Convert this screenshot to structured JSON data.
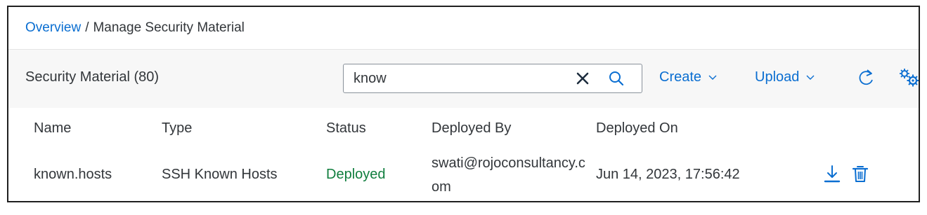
{
  "breadcrumb": {
    "overview": "Overview",
    "separator": "/",
    "current": "Manage Security Material"
  },
  "toolbar": {
    "title": "Security Material (80)",
    "search_value": "know",
    "create_label": "Create",
    "upload_label": "Upload",
    "icons": [
      "clear-icon",
      "search-icon",
      "chevron-down-icon",
      "refresh-icon",
      "settings-gears-icon"
    ]
  },
  "table": {
    "columns": [
      "Name",
      "Type",
      "Status",
      "Deployed By",
      "Deployed On"
    ],
    "rows": [
      {
        "name": "known.hosts",
        "type": "SSH Known Hosts",
        "status": "Deployed",
        "deployed_by": "swati@rojoconsultancy.com",
        "deployed_on": "Jun 14, 2023, 17:56:42",
        "actions": [
          "download-icon",
          "delete-icon"
        ]
      }
    ]
  },
  "colors": {
    "link": "#0a6ed1",
    "status_positive": "#107e3e",
    "text": "#32363a",
    "toolbar_bg": "#f7f7f7",
    "frame_border": "#1f1f1f"
  }
}
